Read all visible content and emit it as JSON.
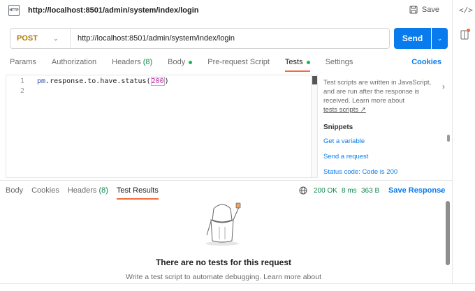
{
  "tab": {
    "icon": "http-icon",
    "icon_text": "HTTP",
    "title": "http://localhost:8501/admin/system/index/login",
    "save_label": "Save"
  },
  "rail": {
    "code_icon": "</>"
  },
  "request": {
    "method": "POST",
    "url": "http://localhost:8501/admin/system/index/login",
    "send_label": "Send"
  },
  "request_tabs": [
    {
      "label": "Params"
    },
    {
      "label": "Authorization"
    },
    {
      "label": "Headers",
      "count": "(8)"
    },
    {
      "label": "Body",
      "dot": true
    },
    {
      "label": "Pre-request Script"
    },
    {
      "label": "Tests",
      "dot": true,
      "active": true
    },
    {
      "label": "Settings"
    }
  ],
  "cookies_label": "Cookies",
  "editor": {
    "lines": [
      {
        "number": "1",
        "obj": "pm",
        "text": ".response.to.have.status(",
        "num": "200",
        "end": ")"
      },
      {
        "number": "2",
        "text": ""
      }
    ]
  },
  "side_panel": {
    "info": "Test scripts are written in JavaScript, and are run after the response is received. Learn more about",
    "link": "tests scripts ↗",
    "snippets_title": "Snippets",
    "snippets": [
      "Get a variable",
      "Send a request",
      "Status code: Code is 200"
    ]
  },
  "response": {
    "tabs": [
      {
        "label": "Body"
      },
      {
        "label": "Cookies"
      },
      {
        "label": "Headers",
        "count": "(8)"
      },
      {
        "label": "Test Results",
        "active": true
      }
    ],
    "status": "200 OK",
    "time": "8 ms",
    "size": "363 B",
    "save_label": "Save Response",
    "empty_title": "There are no tests for this request",
    "empty_subtitle": "Write a test script to automate debugging. Learn more about"
  },
  "colors": {
    "accent": "#f26b3a",
    "primary": "#097bed",
    "method": "#ad7a03",
    "success": "#0e8a4e"
  }
}
